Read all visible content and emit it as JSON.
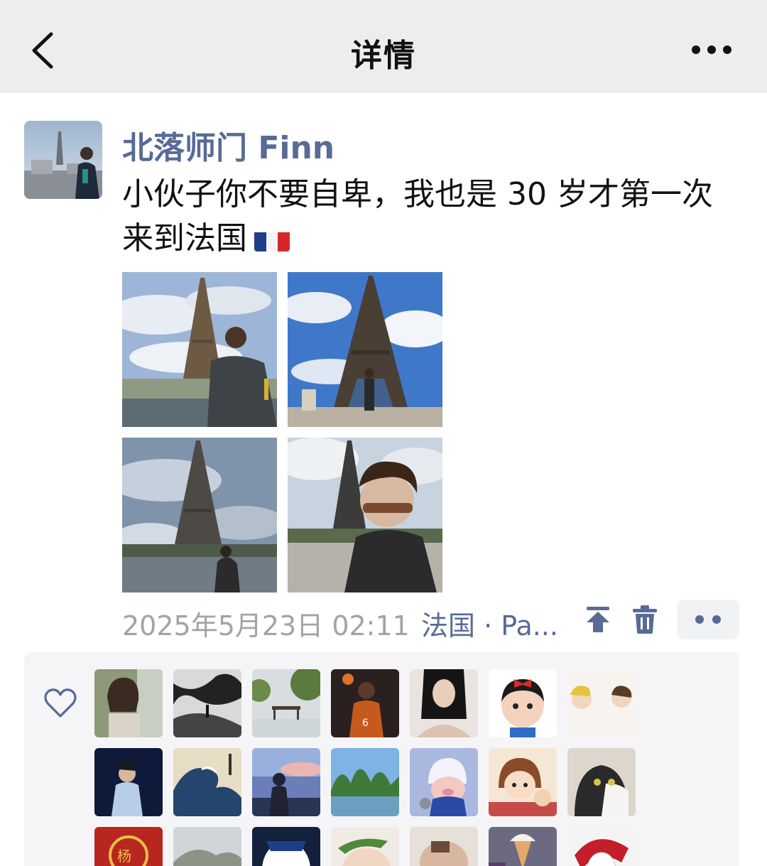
{
  "navbar": {
    "back_icon": "chevron-left-icon",
    "title": "详情",
    "more_icon": "more-dots-icon"
  },
  "post": {
    "author_name": "北落师门 Finn",
    "text_line_1": "小伙子你不要自卑，我也是 30 岁才第一次",
    "text_line_2": "来到法国",
    "flag_emoji": "france-flag-icon",
    "photos": [
      {
        "subject": "man with Eiffel Tower, cloudy river bank"
      },
      {
        "subject": "Eiffel Tower full view, blue sky"
      },
      {
        "subject": "Eiffel Tower over Seine, overcast"
      },
      {
        "subject": "selfie with sunglasses, Eiffel Tower"
      }
    ],
    "timestamp": "2025年5月23日 02:11",
    "location": "法国 · Pa...",
    "pin_icon": "pin-top-icon",
    "delete_icon": "trash-icon",
    "action_icon": "comment-action-dots-icon"
  },
  "likes": {
    "heart_icon": "heart-outline-icon",
    "liker_count_visible": 21
  },
  "colors": {
    "nav_bg": "#ededed",
    "link_blue": "#576b95",
    "meta_gray": "#a3a3a3",
    "panel_bg": "#f5f5f7"
  }
}
